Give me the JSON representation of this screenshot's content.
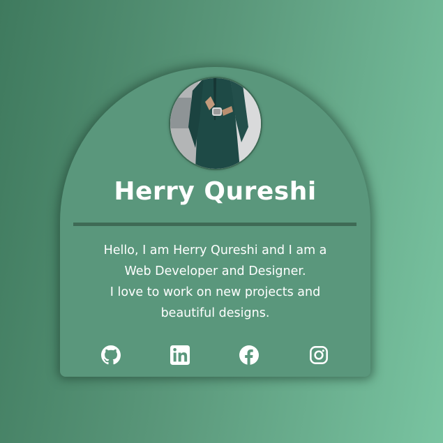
{
  "profile": {
    "name": "Herry Qureshi",
    "bio_lines": [
      "Hello, I am Herry Qureshi and I am a",
      "Web Developer and Designer.",
      "I love to work on new projects and",
      "beautiful designs."
    ],
    "avatar_icon": "profile-photo"
  },
  "socials": [
    {
      "icon": "github-icon"
    },
    {
      "icon": "linkedin-icon"
    },
    {
      "icon": "facebook-icon"
    },
    {
      "icon": "instagram-icon"
    }
  ],
  "colors": {
    "background_start": "#3f7a5e",
    "background_end": "#79c4a1",
    "card": "#5a977c",
    "divider": "#3e6a55",
    "text": "#ffffff"
  }
}
